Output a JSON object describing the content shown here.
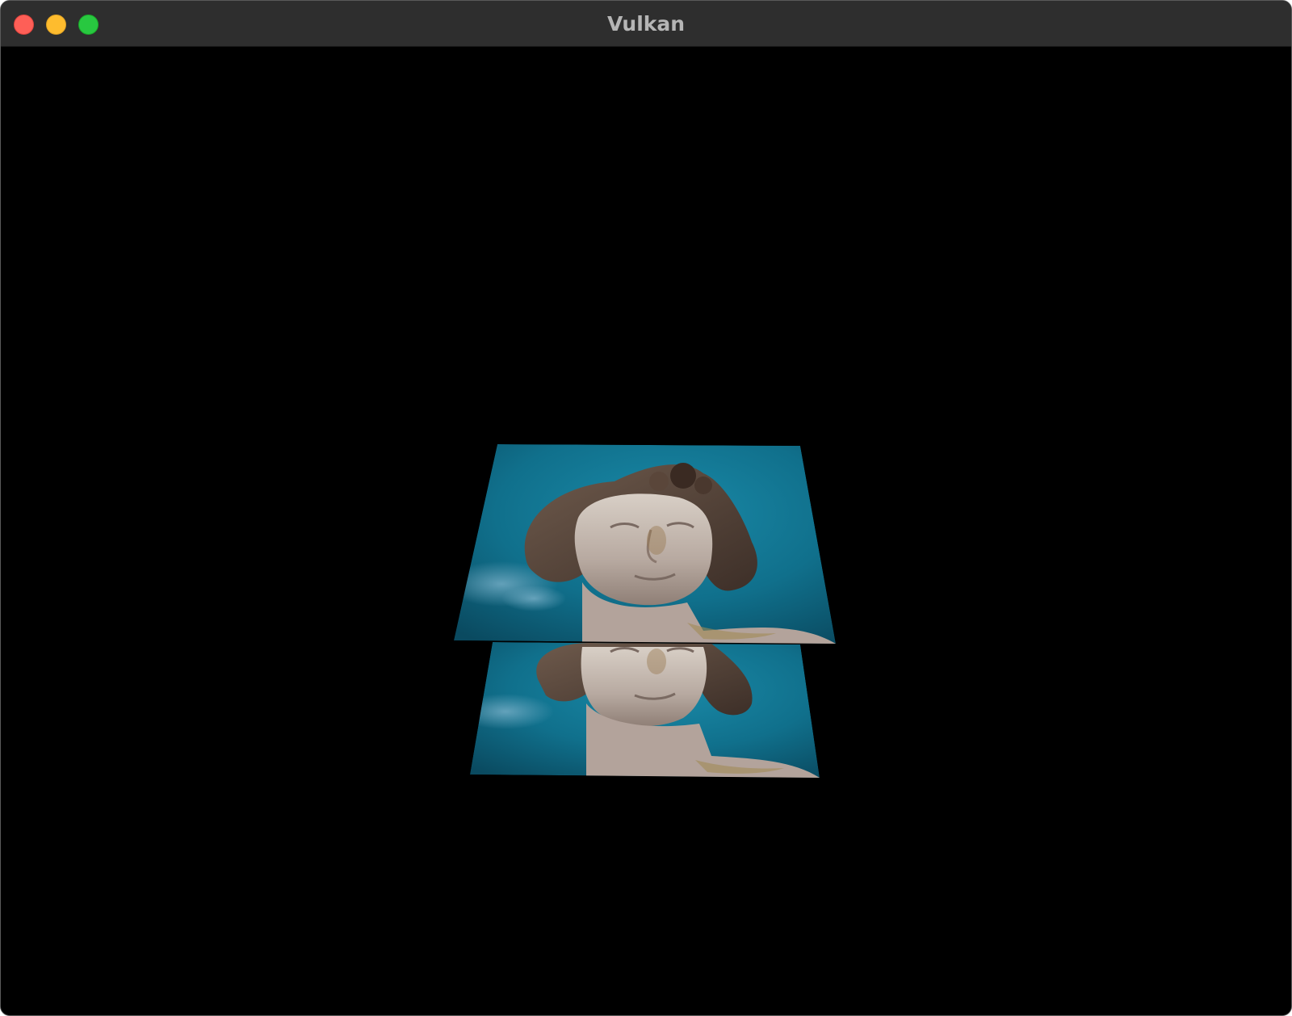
{
  "window": {
    "title": "Vulkan"
  },
  "traffic_lights": {
    "close_color": "#fe5f57",
    "minimize_color": "#febc2e",
    "zoom_color": "#28c840"
  },
  "scene": {
    "background_color": "#000000",
    "description_icon": "textured-quad-statue",
    "quads": [
      {
        "name": "upper-quad",
        "texture": "statue-head-blue-sky"
      },
      {
        "name": "lower-quad",
        "texture": "statue-head-blue-sky"
      }
    ]
  }
}
